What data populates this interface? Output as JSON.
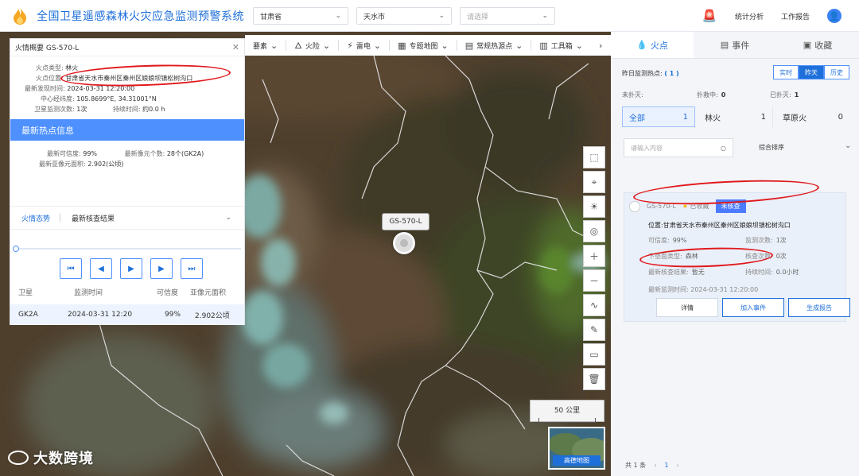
{
  "header": {
    "title": "全国卫星遥感森林火灾应急监测预警系统",
    "province": "甘肃省",
    "city": "天水市",
    "county_placeholder": "请选择",
    "stats": "统计分析",
    "report": "工作报告"
  },
  "toolbar": {
    "items": [
      "要素",
      "火险",
      "雷电",
      "专题地图",
      "常规热源点",
      "工具箱"
    ]
  },
  "map": {
    "marker_label": "GS-570-L",
    "scale": "50 公里",
    "minimap_label": "高德地图",
    "watermark": "大数跨境"
  },
  "left_panel": {
    "title": "火情概要 GS-570-L",
    "fire_type_key": "火点类型",
    "fire_type_value": "林火",
    "location_key": "火点位置",
    "location_value": "甘肃省天水市秦州区秦州区娘娘坝镇松树沟口",
    "latest_time_key": "最新发现时间",
    "latest_time_value": "2024-03-31 12:20:00",
    "center_key": "中心经纬度",
    "center_value": "105.8699°E,  34.31001°N",
    "sat_count_key": "卫星监测次数",
    "sat_count_value": "1次",
    "duration_key": "持续时间",
    "duration_value": "约0.0 h",
    "section_title": "最新热点信息",
    "confidence_key": "最新可信度",
    "confidence_value": "99%",
    "pixels_key": "最新像元个数",
    "pixels_value": "28个(GK2A)",
    "subpixel_key": "最新亚像元面积",
    "subpixel_value": "2.902(公顷)",
    "tab_trend": "火情态势",
    "tab_verify": "最新核查结果",
    "table_headers": [
      "卫星",
      "监测时间",
      "可信度",
      "亚像元面积"
    ],
    "row": [
      "GK2A",
      "2024-03-31 12:20",
      "99%",
      "2.902公顷"
    ]
  },
  "right_panel": {
    "tab_fire": "火点",
    "tab_event": "事件",
    "tab_fav": "收藏",
    "daily_label": "昨日监测热点:",
    "daily_count": "( 1 )",
    "time_buttons": [
      "实时",
      "昨天",
      "历史"
    ],
    "unextinguished_label": "未扑灭:",
    "unextinguished_value": "",
    "fighting_label": "扑救中:",
    "fighting_value": "0",
    "extinguished_label": "已扑灭:",
    "extinguished_value": "1",
    "categories": [
      {
        "label": "全部",
        "count": "1"
      },
      {
        "label": "林火",
        "count": "1"
      },
      {
        "label": "草原火",
        "count": "0"
      }
    ],
    "search_placeholder": "请输入内容",
    "sort_label": "综合排序",
    "card": {
      "id": "GS-570-L",
      "fav": "已收藏",
      "status": "未核查",
      "location": "位置:甘肃省天水市秦州区秦州区娘娘坝镇松树沟口",
      "confidence_key": "可信度:",
      "confidence_value": "99%",
      "monitor_key": "监测次数:",
      "monitor_value": "1次",
      "surface_key": "下垫面类型:",
      "surface_value": "森林",
      "check_key": "核查次数:",
      "check_value": "0次",
      "verify_key": "最新核查结果:",
      "verify_value": "暂无",
      "duration_key": "持续时间:",
      "duration_value": "0.0小时",
      "last_time": "最新监测时间:  2024-03-31 12:20:00",
      "btn_detail": "详情",
      "btn_add": "加入事件",
      "btn_report": "生成报告"
    },
    "pagination_total": "共 1 条",
    "page": "1"
  }
}
